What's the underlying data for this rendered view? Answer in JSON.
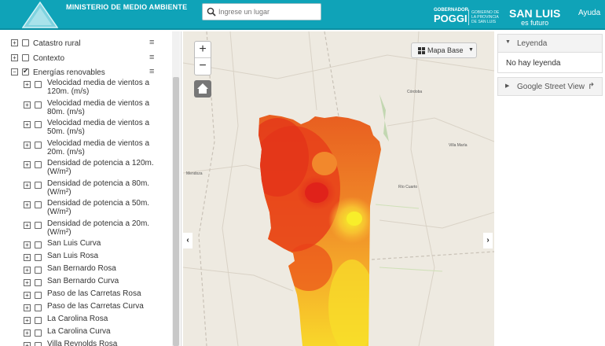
{
  "header": {
    "ministry": "MINISTERIO DE MEDIO AMBIENTE",
    "search_placeholder": "Ingrese un lugar",
    "gov_line1": "GOBERNADOR",
    "gov_name": "POGGI",
    "gov_small": "GOBIERNO DE LA PROVINCIA DE SAN LUIS",
    "brand_line1": "SAN LUIS",
    "brand_line2": "es futuro",
    "help": "Ayuda"
  },
  "sidebar": {
    "groups": [
      {
        "label": "Catastro rural",
        "checked": false
      },
      {
        "label": "Contexto",
        "checked": false
      },
      {
        "label": "Energías renovables",
        "checked": true
      }
    ],
    "items": [
      {
        "label1": "Velocidad media de vientos a",
        "label2": "120m. (m/s)"
      },
      {
        "label1": "Velocidad media de vientos a",
        "label2": "80m. (m/s)"
      },
      {
        "label1": "Velocidad media de vientos a",
        "label2": "50m. (m/s)"
      },
      {
        "label1": "Velocidad media de vientos a",
        "label2": "20m. (m/s)"
      },
      {
        "label1": "Densidad de potencia a 120m.",
        "label2": "(W/m²)"
      },
      {
        "label1": "Densidad de potencia a 80m.",
        "label2": "(W/m²)"
      },
      {
        "label1": "Densidad de potencia a 50m.",
        "label2": "(W/m²)"
      },
      {
        "label1": "Densidad de potencia a 20m.",
        "label2": "(W/m²)"
      },
      {
        "label1": "San Luis Curva"
      },
      {
        "label1": "San Luis Rosa"
      },
      {
        "label1": "San Bernardo Rosa"
      },
      {
        "label1": "San Bernardo Curva"
      },
      {
        "label1": "Paso de las Carretas Rosa"
      },
      {
        "label1": "Paso de las Carretas Curva"
      },
      {
        "label1": "La Carolina Rosa"
      },
      {
        "label1": "La Carolina Curva"
      },
      {
        "label1": "Villa Reynolds Rosa"
      }
    ]
  },
  "map": {
    "basemap_label": "Mapa Base",
    "cities": [
      "Córdoba",
      "Villa María",
      "Río Cuarto",
      "Mendoza",
      "Córdoba"
    ]
  },
  "right_panel": {
    "legend_title": "Leyenda",
    "legend_empty": "No hay leyenda",
    "street_view": "Google Street View"
  },
  "colors": {
    "header": "#0fa3b8",
    "accent": "#ffffff"
  }
}
